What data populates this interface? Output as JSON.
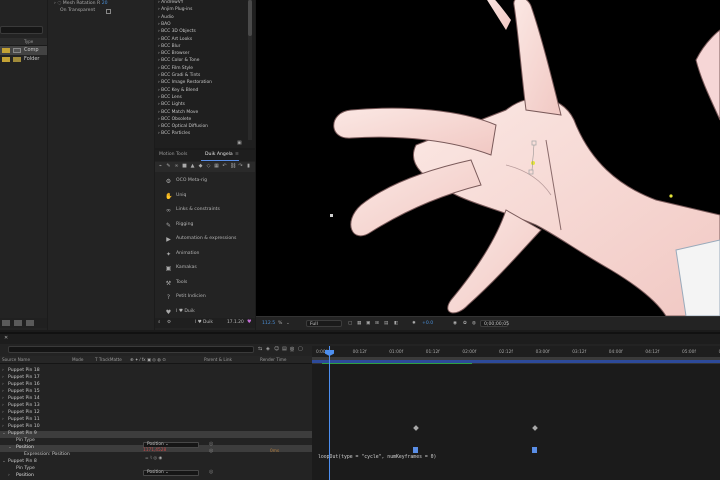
{
  "project": {
    "items": [
      {
        "name": "Comp",
        "color": "#c4a235",
        "selected": true
      },
      {
        "name": "Folder",
        "color": "#c4a235",
        "selected": false
      }
    ]
  },
  "effect_controls": {
    "rows": [
      {
        "label": "Mesh Rotation R",
        "value": "20"
      },
      {
        "label": "On Transparent",
        "value": ""
      }
    ]
  },
  "presets": {
    "items": [
      "AndrewVY",
      "Anjim Plug-ins",
      "Audio",
      "BAO",
      "BCC 3D Objects",
      "BCC Art Looks",
      "BCC Blur",
      "BCC Browser",
      "BCC Color & Tone",
      "BCC Film Style",
      "BCC Gradi & Tints",
      "BCC Image Restoration",
      "BCC Key & Blend",
      "BCC Lens",
      "BCC Lights",
      "BCC Match Move",
      "BCC Obsolete",
      "BCC Optical Diffusion",
      "BCC Particles"
    ]
  },
  "duik": {
    "tabs": [
      "Motion Tools",
      "Duik Angela"
    ],
    "active_tab": "Duik Angela",
    "menu": [
      {
        "icon": "gear-icon",
        "glyph": "⚙",
        "label": "OCO Meta-rig"
      },
      {
        "icon": "hand-icon",
        "glyph": "✋",
        "label": "Uniq"
      },
      {
        "icon": "link-icon",
        "glyph": "∞",
        "label": "Links & constraints"
      },
      {
        "icon": "bone-icon",
        "glyph": "✎",
        "label": "Rigging"
      },
      {
        "icon": "play-icon",
        "glyph": "▶",
        "label": "Automation & expressions"
      },
      {
        "icon": "walk-icon",
        "glyph": "✦",
        "label": "Animation"
      },
      {
        "icon": "camera-icon",
        "glyph": "▣",
        "label": "Kamakas"
      },
      {
        "icon": "tools-icon",
        "glyph": "⚒",
        "label": "Tools"
      },
      {
        "icon": "help-icon",
        "glyph": "?",
        "label": "Petit Indicien"
      },
      {
        "icon": "heart-icon",
        "glyph": "♥",
        "label": "I ♥ Duik"
      }
    ],
    "footer_left": "I ♥ Duik",
    "footer_right": "17.1.20"
  },
  "viewer_bar": {
    "zoom": "112.5",
    "resolution": "Full",
    "exposure": "+0.0",
    "timecode": "0;00;00;05"
  },
  "timeline": {
    "columns": [
      "Source Name",
      "Mode",
      "T TrackMatte",
      "Parent & Link",
      "Render Time"
    ],
    "ruler": [
      "0:00f",
      "00:12f",
      "01:00f",
      "01:12f",
      "02:00f",
      "02:12f",
      "03:00f",
      "03:12f",
      "04:00f",
      "04:12f",
      "05:00f",
      "05:1"
    ],
    "layers": [
      {
        "name": "Puppet Pin 18",
        "level": 0,
        "twirl": "›"
      },
      {
        "name": "Puppet Pin 17",
        "level": 0,
        "twirl": "›"
      },
      {
        "name": "Puppet Pin 16",
        "level": 0,
        "twirl": "›"
      },
      {
        "name": "Puppet Pin 15",
        "level": 0,
        "twirl": "›"
      },
      {
        "name": "Puppet Pin 14",
        "level": 0,
        "twirl": "›"
      },
      {
        "name": "Puppet Pin 13",
        "level": 0,
        "twirl": "›"
      },
      {
        "name": "Puppet Pin 12",
        "level": 0,
        "twirl": "›"
      },
      {
        "name": "Puppet Pin 11",
        "level": 0,
        "twirl": "›"
      },
      {
        "name": "Puppet Pin 10",
        "level": 0,
        "twirl": "›"
      },
      {
        "name": "Puppet Pin 9",
        "level": 0,
        "twirl": "⌄",
        "selected": true
      },
      {
        "name": "Pin Type",
        "level": 1,
        "twirl": ""
      },
      {
        "name": "Position",
        "level": 1,
        "twirl": "⌄",
        "selected": true
      },
      {
        "name": "Expression: Position",
        "level": 2,
        "twirl": ""
      },
      {
        "name": "Puppet Pin 8",
        "level": 0,
        "twirl": "⌄"
      },
      {
        "name": "Pin Type",
        "level": 1,
        "twirl": ""
      },
      {
        "name": "Position",
        "level": 1,
        "twirl": "›"
      }
    ],
    "pin_type_value": "Position",
    "position_value": "1171,4528",
    "render_time": "0ms",
    "expression": "loopOut(type = \"cycle\", numKeyframes = 0)"
  }
}
